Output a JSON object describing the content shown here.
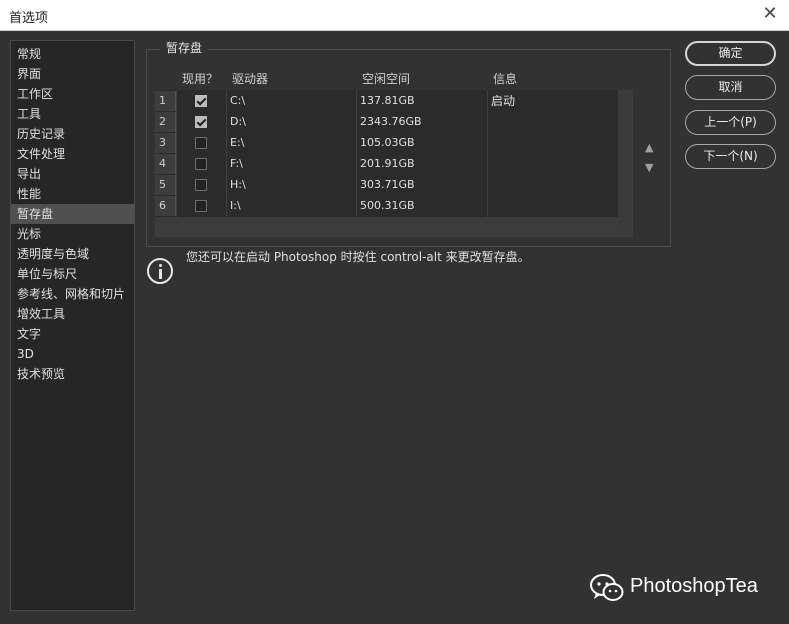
{
  "window": {
    "title": "首选项",
    "close_glyph": "✕"
  },
  "sidebar": {
    "items": [
      {
        "label": "常规"
      },
      {
        "label": "界面"
      },
      {
        "label": "工作区"
      },
      {
        "label": "工具"
      },
      {
        "label": "历史记录"
      },
      {
        "label": "文件处理"
      },
      {
        "label": "导出"
      },
      {
        "label": "性能"
      },
      {
        "label": "暂存盘",
        "active": true
      },
      {
        "label": "光标"
      },
      {
        "label": "透明度与色域"
      },
      {
        "label": "单位与标尺"
      },
      {
        "label": "参考线、网格和切片"
      },
      {
        "label": "增效工具"
      },
      {
        "label": "文字"
      },
      {
        "label": "3D"
      },
      {
        "label": "技术预览"
      }
    ]
  },
  "scratch": {
    "title": "暂存盘",
    "columns": {
      "active": "现用？",
      "drive": "驱动器",
      "space": "空闲空间",
      "info": "信息"
    },
    "rows": [
      {
        "num": "1",
        "checked": true,
        "drive": "C:\\",
        "space": "137.81GB",
        "info": "启动"
      },
      {
        "num": "2",
        "checked": true,
        "drive": "D:\\",
        "space": "2343.76GB",
        "info": ""
      },
      {
        "num": "3",
        "checked": false,
        "drive": "E:\\",
        "space": "105.03GB",
        "info": ""
      },
      {
        "num": "4",
        "checked": false,
        "drive": "F:\\",
        "space": "201.91GB",
        "info": ""
      },
      {
        "num": "5",
        "checked": false,
        "drive": "H:\\",
        "space": "303.71GB",
        "info": ""
      },
      {
        "num": "6",
        "checked": false,
        "drive": "I:\\",
        "space": "500.31GB",
        "info": ""
      }
    ],
    "move_up_glyph": "▲",
    "move_down_glyph": "▼"
  },
  "hint": {
    "text": "您还可以在启动 Photoshop 时按住 control-alt 来更改暂存盘。"
  },
  "buttons": {
    "ok": "确定",
    "cancel": "取消",
    "prev": "上一个(P)",
    "next": "下一个(N)"
  },
  "watermark": {
    "text": "PhotoshopTea",
    "icon": "wechat-icon"
  }
}
